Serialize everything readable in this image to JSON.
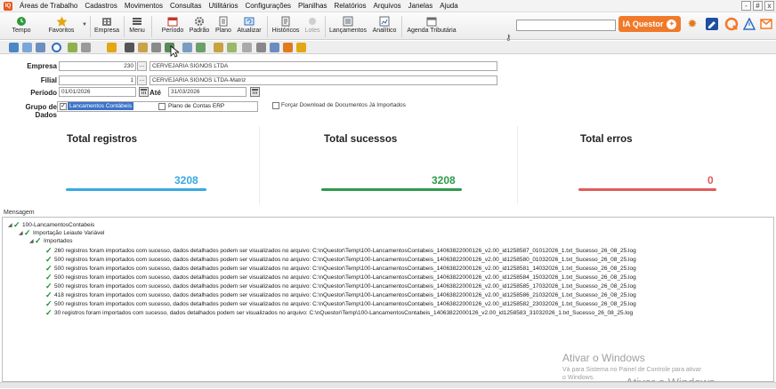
{
  "app": {
    "icon_text": "IQ",
    "menu": [
      "Áreas de Trabalho",
      "Cadastros",
      "Movimentos",
      "Consultas",
      "Utilitários",
      "Configurações",
      "Planilhas",
      "Relatórios",
      "Arquivos",
      "Janelas",
      "Ajuda"
    ],
    "window_controls": [
      "-",
      "#",
      "x"
    ]
  },
  "ribbon": {
    "buttons": [
      {
        "label": "Tempo",
        "icon": "clock-icon",
        "color": "#2e9a3a"
      },
      {
        "label": "Favoritos",
        "icon": "star-icon",
        "color": "#e3a712"
      },
      {
        "label": "Empresa",
        "icon": "building-icon",
        "color": "#555555"
      },
      {
        "label": "Menu",
        "icon": "menu-icon",
        "color": "#555555"
      },
      {
        "label": "Período",
        "icon": "period-icon",
        "color": "#c0392b"
      },
      {
        "label": "Padrão",
        "icon": "gear-icon",
        "color": "#6a6a6a"
      },
      {
        "label": "Plano",
        "icon": "plan-icon",
        "color": "#6a6a6a"
      },
      {
        "label": "Atualizar",
        "icon": "refresh-icon",
        "color": "#2f6fbf"
      },
      {
        "label": "Históricos",
        "icon": "history-icon",
        "color": "#6a6a6a"
      },
      {
        "label": "Lotes",
        "icon": "batch-icon",
        "color": "#9a9a9a",
        "disabled": true
      },
      {
        "label": "Lançamentos",
        "icon": "entries-icon",
        "color": "#6a6a6a"
      },
      {
        "label": "Analítico",
        "icon": "analytic-icon",
        "color": "#6a6a6a"
      },
      {
        "label": "Agenda Tributária",
        "icon": "calendar-icon",
        "color": "#6a6a6a"
      }
    ],
    "search_value": "",
    "ia_button": "IA Questor",
    "right_icons": [
      "sun-icon",
      "edit-icon",
      "questor-logo-icon",
      "alert-icon",
      "mail-icon"
    ]
  },
  "form": {
    "empresa_label": "Empresa",
    "empresa_code": "230",
    "empresa_name": "CERVEJARIA SIGNOS LTDA",
    "filial_label": "Filial",
    "filial_code": "1",
    "filial_name": "CERVEJARIA SIGNOS LTDA-Matriz",
    "periodo_label": "Período",
    "periodo_start": "01/01/2026",
    "ate_label": "Até",
    "periodo_end": "31/03/2026",
    "grupo_label": "Grupo de Dados",
    "grupo_option_1": "Lancamentos Contábeis",
    "grupo_option_1_checked": true,
    "grupo_option_2": "Plano de Contas ERP",
    "grupo_option_2_checked": false,
    "forcar_label": "Forçar Download de Documentos Já Importados",
    "forcar_checked": false,
    "browse_btn": "..."
  },
  "stats": {
    "total_label": "Total registros",
    "total_value": "3208",
    "total_color": "#36a9e1",
    "success_label": "Total sucessos",
    "success_value": "3208",
    "success_color": "#2e9a4a",
    "errors_label": "Total erros",
    "errors_value": "0",
    "errors_color": "#e05a5a"
  },
  "messages": {
    "label": "Mensagem",
    "root": "100-LancamentosContabeis",
    "level1": "Importação Leiaute Variável",
    "level2": "Importados",
    "rows": [
      "260 registros foram importados com sucesso, dados detalhados podem ser visualizados no arquivo: C:\\nQuestor\\Temp\\100-LancamentosContabeis_14063822000126_v2.00_id1258587_01012026_1.txt_Sucesso_26_08_25.log",
      "500 registros foram importados com sucesso, dados detalhados podem ser visualizados no arquivo: C:\\nQuestor\\Temp\\100-LancamentosContabeis_14063822000126_v2.00_id1258580_01032026_1.txt_Sucesso_26_08_25.log",
      "500 registros foram importados com sucesso, dados detalhados podem ser visualizados no arquivo: C:\\nQuestor\\Temp\\100-LancamentosContabeis_14063822000126_v2.00_id1258581_14032026_1.txt_Sucesso_26_08_25.log",
      "500 registros foram importados com sucesso, dados detalhados podem ser visualizados no arquivo: C:\\nQuestor\\Temp\\100-LancamentosContabeis_14063822000126_v2.00_id1258584_15032026_1.txt_Sucesso_26_08_25.log",
      "500 registros foram importados com sucesso, dados detalhados podem ser visualizados no arquivo: C:\\nQuestor\\Temp\\100-LancamentosContabeis_14063822000126_v2.00_id1258585_17032026_1.txt_Sucesso_26_08_25.log",
      "418 registros foram importados com sucesso, dados detalhados podem ser visualizados no arquivo: C:\\nQuestor\\Temp\\100-LancamentosContabeis_14063822000126_v2.00_id1258586_21032026_1.txt_Sucesso_26_08_25.log",
      "500 registros foram importados com sucesso, dados detalhados podem ser visualizados no arquivo: C:\\nQuestor\\Temp\\100-LancamentosContabeis_14063822000126_v2.00_id1258582_23032026_1.txt_Sucesso_26_08_25.log",
      "30 registros foram importados com sucesso, dados detalhados podem ser visualizados no arquivo: C:\\nQuestor\\Temp\\100-LancamentosContabeis_14063822000126_v2.00_id1258583_31032026_1.txt_Sucesso_26_08_25.log"
    ]
  },
  "watermark": {
    "line1": "Ativar o Windows",
    "line2": "Vá para Sistema no Painel de Controle para ativar",
    "line3": "o Windows.",
    "line4": "Ativar o Windows"
  }
}
